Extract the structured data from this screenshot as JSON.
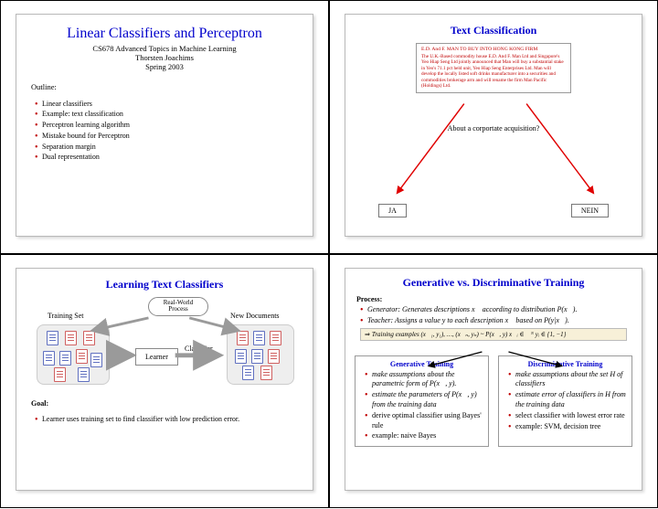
{
  "slide1": {
    "title": "Linear Classifiers and Perceptron",
    "course": "CS678 Advanced Topics in Machine Learning",
    "author": "Thorsten Joachims",
    "term": "Spring 2003",
    "outline_label": "Outline:",
    "outline": [
      "Linear classifiers",
      "Example: text classification",
      "Perceptron learning algorithm",
      "Mistake bound for Perceptron",
      "Separation margin",
      "Dual representation"
    ]
  },
  "slide2": {
    "title": "Text Classification",
    "news_head": "E.D. And F. MAN TO BUY INTO HONG KONG FIRM",
    "news_body": "The U.K.-Based commodity house E.D. And F. Man Ltd and Singapore's Yeo Hiap Seng Ltd jointly announced that Man will buy a substantial stake in Yeo's 71.1 pct held unit, Yeo Hiap Seng Enterprises Ltd. Man will develop the locally listed soft drinks manufacturer into a securities and commodities brokerage arm and will rename the firm Man Pacific (Holdings) Ltd.",
    "question": "About a corportate acquisition?",
    "yes": "JA",
    "no": "NEIN"
  },
  "slide3": {
    "title": "Learning Text Classifiers",
    "realworld": "Real-World Process",
    "training_set": "Training Set",
    "new_docs": "New Documents",
    "learner": "Learner",
    "classifier": "Classifier",
    "goal_label": "Goal:",
    "goal_text": "Learner uses training set to find classifier with low prediction error."
  },
  "slide4": {
    "title": "Generative vs. Discriminative Training",
    "process_label": "Process:",
    "process": [
      "Generator: Generates descriptions x⃗ according to distribution P(x⃗).",
      "Teacher: Assigns a value y to each description x⃗ based on P(y|x⃗)."
    ],
    "train_line": "Training examples  (x⃗₁, y₁), …, (x⃗ₙ, yₙ) ~ P(x⃗, y)   x⃗ᵢ ∈ ℜᴺ  yᵢ ∈ {1, −1}",
    "gen": {
      "title": "Generative Training",
      "items": [
        "make assumptions about the parametric form of P(x⃗, y).",
        "estimate the parameters of P(x⃗, y) from the training data",
        "derive optimal classifier using Bayes' rule",
        "example: naive Bayes"
      ]
    },
    "disc": {
      "title": "Discriminative Training",
      "items": [
        "make assumptions about the set H of classifiers",
        "estimate error of classifiers in H from the training data",
        "select classifier with lowest error rate",
        "example: SVM, decision tree"
      ]
    }
  }
}
